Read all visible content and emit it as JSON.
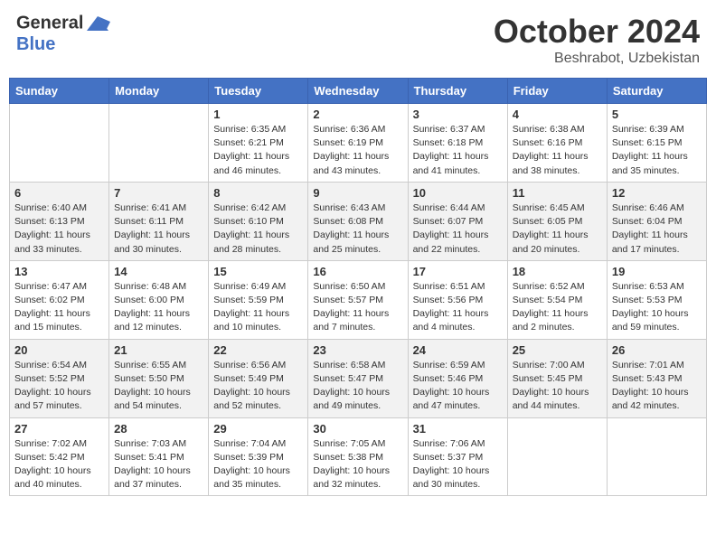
{
  "header": {
    "logo_line1": "General",
    "logo_line2": "Blue",
    "title": "October 2024",
    "subtitle": "Beshrabot, Uzbekistan"
  },
  "days_of_week": [
    "Sunday",
    "Monday",
    "Tuesday",
    "Wednesday",
    "Thursday",
    "Friday",
    "Saturday"
  ],
  "weeks": [
    [
      {
        "day": "",
        "info": ""
      },
      {
        "day": "",
        "info": ""
      },
      {
        "day": "1",
        "info": "Sunrise: 6:35 AM\nSunset: 6:21 PM\nDaylight: 11 hours and 46 minutes."
      },
      {
        "day": "2",
        "info": "Sunrise: 6:36 AM\nSunset: 6:19 PM\nDaylight: 11 hours and 43 minutes."
      },
      {
        "day": "3",
        "info": "Sunrise: 6:37 AM\nSunset: 6:18 PM\nDaylight: 11 hours and 41 minutes."
      },
      {
        "day": "4",
        "info": "Sunrise: 6:38 AM\nSunset: 6:16 PM\nDaylight: 11 hours and 38 minutes."
      },
      {
        "day": "5",
        "info": "Sunrise: 6:39 AM\nSunset: 6:15 PM\nDaylight: 11 hours and 35 minutes."
      }
    ],
    [
      {
        "day": "6",
        "info": "Sunrise: 6:40 AM\nSunset: 6:13 PM\nDaylight: 11 hours and 33 minutes."
      },
      {
        "day": "7",
        "info": "Sunrise: 6:41 AM\nSunset: 6:11 PM\nDaylight: 11 hours and 30 minutes."
      },
      {
        "day": "8",
        "info": "Sunrise: 6:42 AM\nSunset: 6:10 PM\nDaylight: 11 hours and 28 minutes."
      },
      {
        "day": "9",
        "info": "Sunrise: 6:43 AM\nSunset: 6:08 PM\nDaylight: 11 hours and 25 minutes."
      },
      {
        "day": "10",
        "info": "Sunrise: 6:44 AM\nSunset: 6:07 PM\nDaylight: 11 hours and 22 minutes."
      },
      {
        "day": "11",
        "info": "Sunrise: 6:45 AM\nSunset: 6:05 PM\nDaylight: 11 hours and 20 minutes."
      },
      {
        "day": "12",
        "info": "Sunrise: 6:46 AM\nSunset: 6:04 PM\nDaylight: 11 hours and 17 minutes."
      }
    ],
    [
      {
        "day": "13",
        "info": "Sunrise: 6:47 AM\nSunset: 6:02 PM\nDaylight: 11 hours and 15 minutes."
      },
      {
        "day": "14",
        "info": "Sunrise: 6:48 AM\nSunset: 6:00 PM\nDaylight: 11 hours and 12 minutes."
      },
      {
        "day": "15",
        "info": "Sunrise: 6:49 AM\nSunset: 5:59 PM\nDaylight: 11 hours and 10 minutes."
      },
      {
        "day": "16",
        "info": "Sunrise: 6:50 AM\nSunset: 5:57 PM\nDaylight: 11 hours and 7 minutes."
      },
      {
        "day": "17",
        "info": "Sunrise: 6:51 AM\nSunset: 5:56 PM\nDaylight: 11 hours and 4 minutes."
      },
      {
        "day": "18",
        "info": "Sunrise: 6:52 AM\nSunset: 5:54 PM\nDaylight: 11 hours and 2 minutes."
      },
      {
        "day": "19",
        "info": "Sunrise: 6:53 AM\nSunset: 5:53 PM\nDaylight: 10 hours and 59 minutes."
      }
    ],
    [
      {
        "day": "20",
        "info": "Sunrise: 6:54 AM\nSunset: 5:52 PM\nDaylight: 10 hours and 57 minutes."
      },
      {
        "day": "21",
        "info": "Sunrise: 6:55 AM\nSunset: 5:50 PM\nDaylight: 10 hours and 54 minutes."
      },
      {
        "day": "22",
        "info": "Sunrise: 6:56 AM\nSunset: 5:49 PM\nDaylight: 10 hours and 52 minutes."
      },
      {
        "day": "23",
        "info": "Sunrise: 6:58 AM\nSunset: 5:47 PM\nDaylight: 10 hours and 49 minutes."
      },
      {
        "day": "24",
        "info": "Sunrise: 6:59 AM\nSunset: 5:46 PM\nDaylight: 10 hours and 47 minutes."
      },
      {
        "day": "25",
        "info": "Sunrise: 7:00 AM\nSunset: 5:45 PM\nDaylight: 10 hours and 44 minutes."
      },
      {
        "day": "26",
        "info": "Sunrise: 7:01 AM\nSunset: 5:43 PM\nDaylight: 10 hours and 42 minutes."
      }
    ],
    [
      {
        "day": "27",
        "info": "Sunrise: 7:02 AM\nSunset: 5:42 PM\nDaylight: 10 hours and 40 minutes."
      },
      {
        "day": "28",
        "info": "Sunrise: 7:03 AM\nSunset: 5:41 PM\nDaylight: 10 hours and 37 minutes."
      },
      {
        "day": "29",
        "info": "Sunrise: 7:04 AM\nSunset: 5:39 PM\nDaylight: 10 hours and 35 minutes."
      },
      {
        "day": "30",
        "info": "Sunrise: 7:05 AM\nSunset: 5:38 PM\nDaylight: 10 hours and 32 minutes."
      },
      {
        "day": "31",
        "info": "Sunrise: 7:06 AM\nSunset: 5:37 PM\nDaylight: 10 hours and 30 minutes."
      },
      {
        "day": "",
        "info": ""
      },
      {
        "day": "",
        "info": ""
      }
    ]
  ]
}
